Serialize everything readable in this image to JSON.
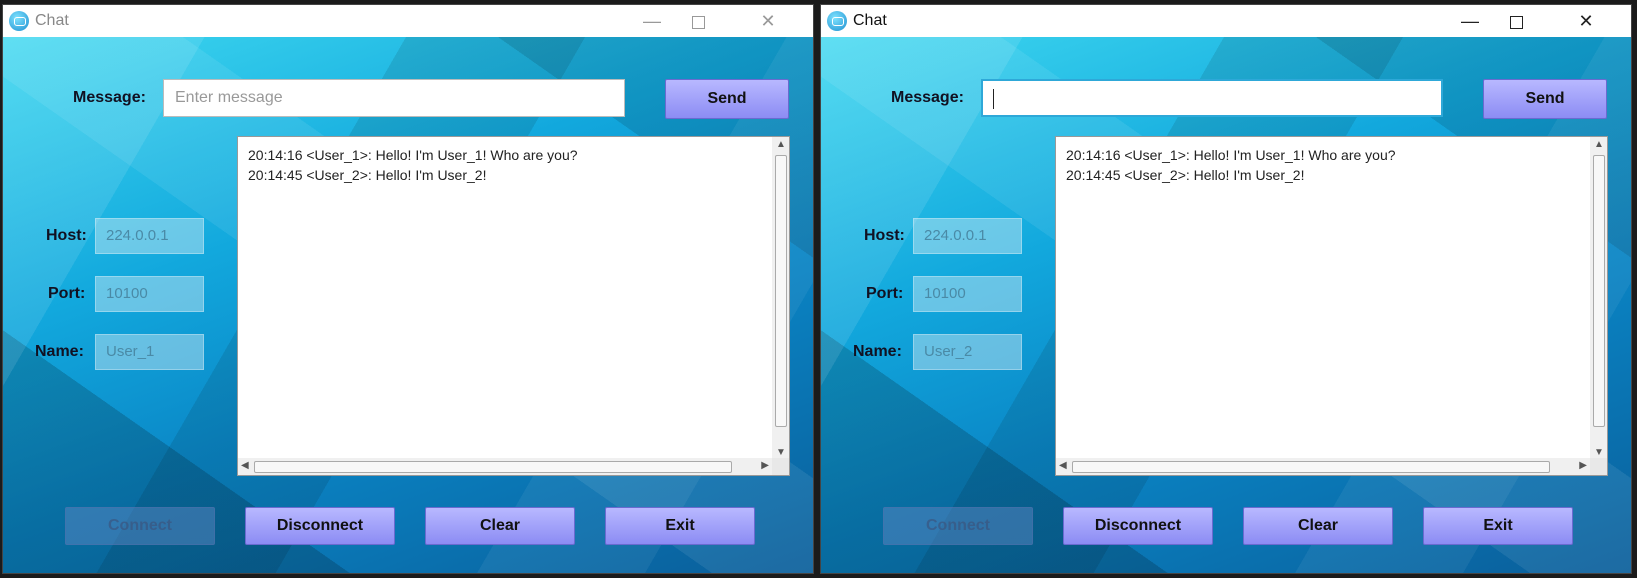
{
  "windows": [
    {
      "title": "Chat",
      "message_label": "Message:",
      "message_value": "",
      "message_placeholder": "Enter message",
      "send_label": "Send",
      "host_label": "Host:",
      "host_value": "224.0.0.1",
      "port_label": "Port:",
      "port_value": "10100",
      "name_label": "Name:",
      "name_value": "User_1",
      "log": [
        "20:14:16 <User_1>: Hello! I'm User_1! Who are you?",
        "20:14:45 <User_2>: Hello! I'm User_2!"
      ],
      "buttons": {
        "connect": "Connect",
        "disconnect": "Disconnect",
        "clear": "Clear",
        "exit": "Exit"
      }
    },
    {
      "title": "Chat",
      "message_label": "Message:",
      "message_value": "",
      "message_placeholder": "",
      "send_label": "Send",
      "host_label": "Host:",
      "host_value": "224.0.0.1",
      "port_label": "Port:",
      "port_value": "10100",
      "name_label": "Name:",
      "name_value": "User_2",
      "log": [
        "20:14:16 <User_1>: Hello! I'm User_1! Who are you?",
        "20:14:45 <User_2>: Hello! I'm User_2!"
      ],
      "buttons": {
        "connect": "Connect",
        "disconnect": "Disconnect",
        "clear": "Clear",
        "exit": "Exit"
      }
    }
  ],
  "icons": {
    "app": "chat-bubble-icon",
    "minimize": "minimize-icon",
    "maximize": "maximize-icon",
    "close": "close-icon"
  },
  "colors": {
    "button_gradient_top": "#b8b8ff",
    "button_gradient_bottom": "#8c8cf4",
    "background_light": "#3fd8f0",
    "background_dark": "#0a5e9a",
    "focus_border": "#2ea8d8"
  }
}
